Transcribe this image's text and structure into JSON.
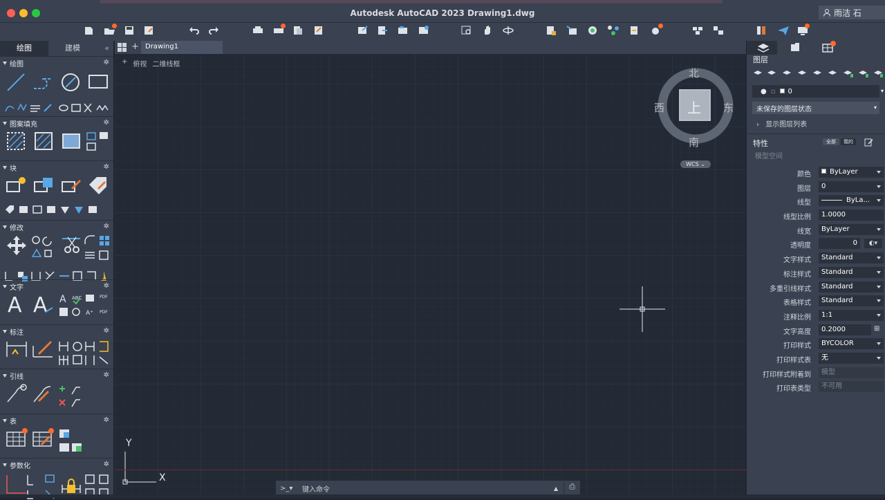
{
  "window": {
    "title": "Autodesk AutoCAD 2023    Drawing1.dwg",
    "user": "雨洁 石"
  },
  "left_panel": {
    "tabs": [
      "绘图",
      "建模"
    ],
    "collapse": "«",
    "sections": [
      {
        "title": "绘图"
      },
      {
        "title": "图案填充"
      },
      {
        "title": "块"
      },
      {
        "title": "修改"
      },
      {
        "title": "文字"
      },
      {
        "title": "标注"
      },
      {
        "title": "引线"
      },
      {
        "title": "表"
      },
      {
        "title": "参数化"
      }
    ]
  },
  "document": {
    "tab": "Drawing1",
    "view_controls": [
      "+",
      "俯视",
      "二维线框"
    ]
  },
  "viewcube": {
    "north": "北",
    "south": "南",
    "east": "东",
    "west": "西",
    "top": "上",
    "wcs": "WCS"
  },
  "ucs": {
    "x": "X",
    "y": "Y"
  },
  "command": {
    "prompt": ">_▾",
    "placeholder": "键入命令"
  },
  "right_panel": {
    "layers_title": "图层",
    "current_layer": "0",
    "layer_state": "未保存的图层状态",
    "show_list": "显示图层列表",
    "properties_title": "特性",
    "pill_all": "全部",
    "pill_mine": "我的",
    "model_space": "模型空间",
    "properties": [
      {
        "label": "颜色",
        "value": "ByLayer"
      },
      {
        "label": "图层",
        "value": "0"
      },
      {
        "label": "线型",
        "value": "ByLa..."
      },
      {
        "label": "线型比例",
        "value": "1.0000"
      },
      {
        "label": "线宽",
        "value": "ByLayer"
      },
      {
        "label": "透明度",
        "value": "0"
      },
      {
        "label": "文字样式",
        "value": "Standard"
      },
      {
        "label": "标注样式",
        "value": "Standard"
      },
      {
        "label": "多重引线样式",
        "value": "Standard"
      },
      {
        "label": "表格样式",
        "value": "Standard"
      },
      {
        "label": "注释比例",
        "value": "1:1"
      },
      {
        "label": "文字高度",
        "value": "0.2000"
      },
      {
        "label": "打印样式",
        "value": "BYCOLOR"
      },
      {
        "label": "打印样式表",
        "value": "无"
      },
      {
        "label": "打印样式附着到",
        "value": "模型"
      },
      {
        "label": "打印表类型",
        "value": "不可用"
      }
    ]
  },
  "colors": {
    "canvas": "#232a36",
    "panel": "#3a4150",
    "accent_badge": "#ff6b2c"
  }
}
